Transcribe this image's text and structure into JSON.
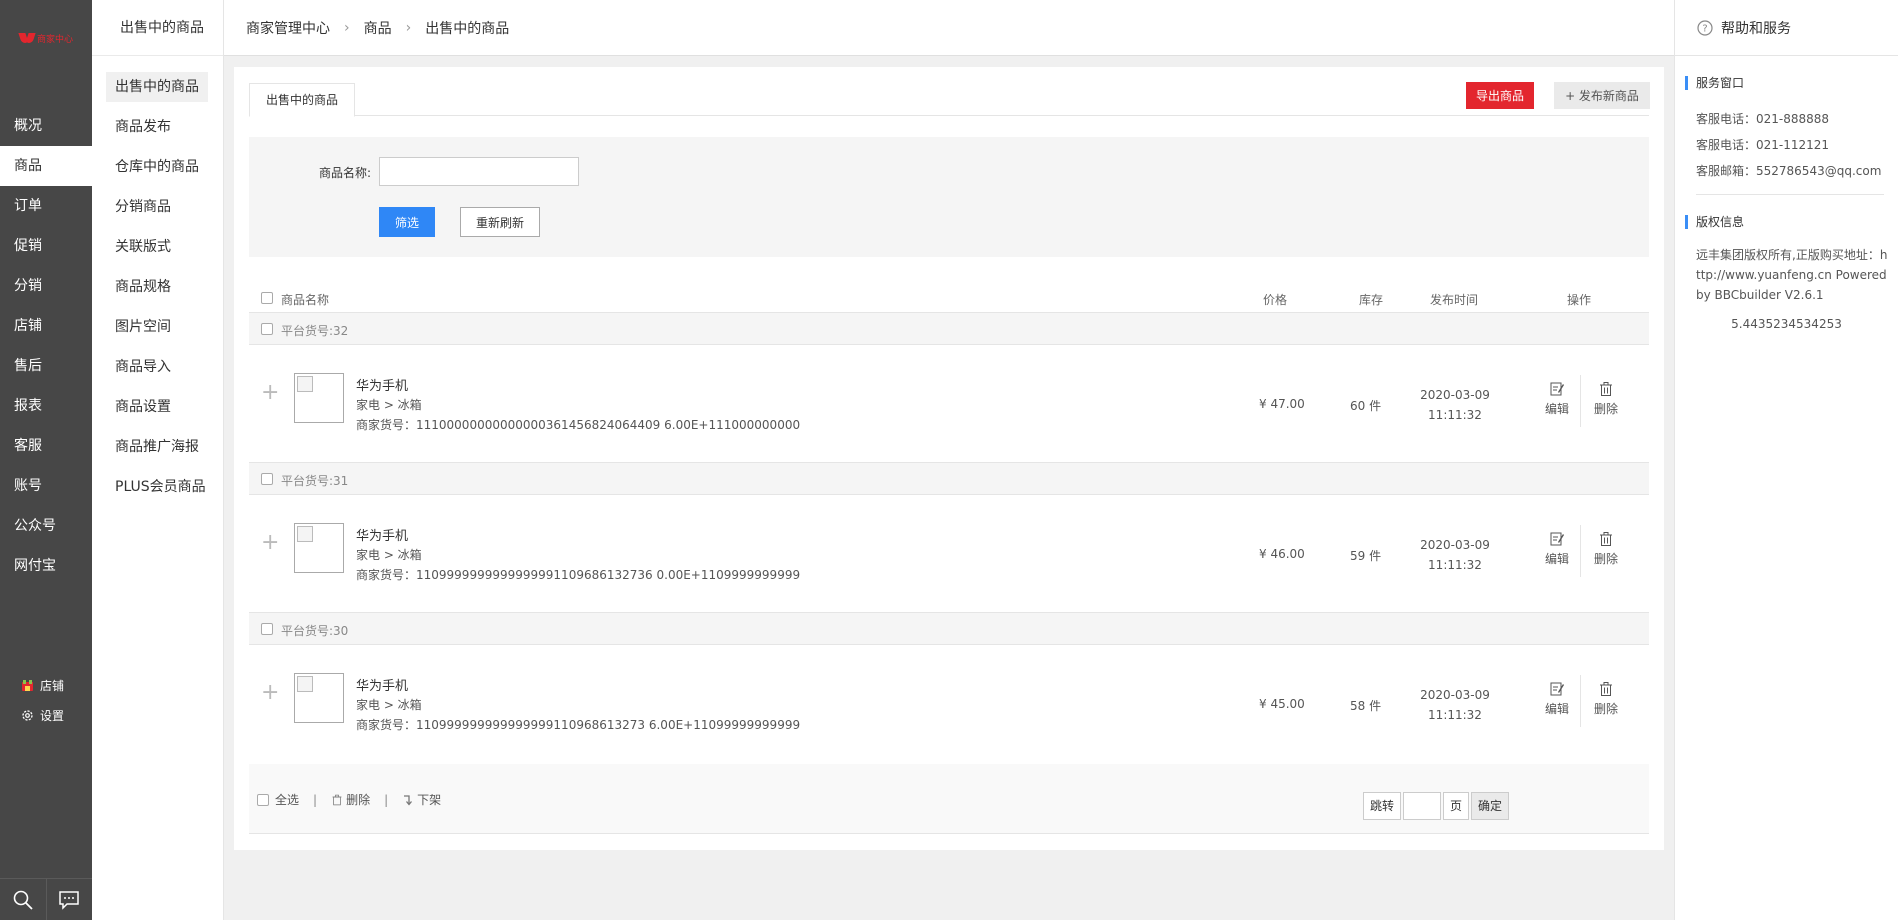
{
  "logo": {
    "text": "商家中心"
  },
  "leftnav": {
    "items": [
      {
        "label": "概况"
      },
      {
        "label": "商品",
        "active": true
      },
      {
        "label": "订单"
      },
      {
        "label": "促销"
      },
      {
        "label": "分销"
      },
      {
        "label": "店铺"
      },
      {
        "label": "售后"
      },
      {
        "label": "报表"
      },
      {
        "label": "客服"
      },
      {
        "label": "账号"
      },
      {
        "label": "公众号"
      },
      {
        "label": "网付宝"
      }
    ],
    "store_label": "店铺",
    "settings_label": "设置"
  },
  "subnav": {
    "title": "出售中的商品",
    "items": [
      {
        "label": "出售中的商品",
        "active": true
      },
      {
        "label": "商品发布"
      },
      {
        "label": "仓库中的商品"
      },
      {
        "label": "分销商品"
      },
      {
        "label": "关联版式"
      },
      {
        "label": "商品规格"
      },
      {
        "label": "图片空间"
      },
      {
        "label": "商品导入"
      },
      {
        "label": "商品设置"
      },
      {
        "label": "商品推广海报"
      },
      {
        "label": "PLUS会员商品"
      }
    ]
  },
  "breadcrumb": {
    "items": [
      "商家管理中心",
      "商品",
      "出售中的商品"
    ],
    "separator": "›"
  },
  "help": {
    "title": "帮助和服务",
    "service_title": "服务窗口",
    "service_lines": [
      "客服电话：021-888888",
      "客服电话：021-112121",
      "客服邮箱：552786543@qq.com"
    ],
    "copyright_title": "版权信息",
    "copyright_text": "远丰集团版权所有,正版购买地址：http://www.yuanfeng.cn Powered by BBCbuilder V2.6.1",
    "copyright_number": "5.4435234534253"
  },
  "main": {
    "tab_label": "出售中的商品",
    "export_label": "导出商品",
    "publish_label": "+ 发布新商品",
    "filter": {
      "name_label": "商品名称:",
      "name_value": "",
      "filter_button": "筛选",
      "reset_button": "重新刷新"
    },
    "table_headers": {
      "name": "商品名称",
      "price": "价格",
      "stock": "库存",
      "time": "发布时间",
      "ops": "操作"
    },
    "groups": [
      {
        "header": "平台货号:32",
        "name": "华为手机",
        "category": "家电 > 冰箱",
        "sku": "商家货号：11100000000000000361456824064409 6.00E+111000000000",
        "price": "¥ 47.00",
        "stock": "60 件",
        "time_date": "2020-03-09",
        "time_clock": "11:11:32"
      },
      {
        "header": "平台货号:31",
        "name": "华为手机",
        "category": "家电 > 冰箱",
        "sku": "商家货号：1109999999999999991109686132736 0.00E+1109999999999",
        "price": "¥ 46.00",
        "stock": "59 件",
        "time_date": "2020-03-09",
        "time_clock": "11:11:32"
      },
      {
        "header": "平台货号:30",
        "name": "华为手机",
        "category": "家电 > 冰箱",
        "sku": "商家货号：110999999999999999110968613273 6.00E+11099999999999",
        "price": "¥ 45.00",
        "stock": "58 件",
        "time_date": "2020-03-09",
        "time_clock": "11:11:32"
      }
    ],
    "op_edit": "编辑",
    "op_delete": "删除",
    "footer": {
      "select_all": "全选",
      "delete": "删除",
      "offshelf": "下架",
      "jump": "跳转",
      "page_value": "",
      "page_unit": "页",
      "confirm": "确定"
    }
  }
}
